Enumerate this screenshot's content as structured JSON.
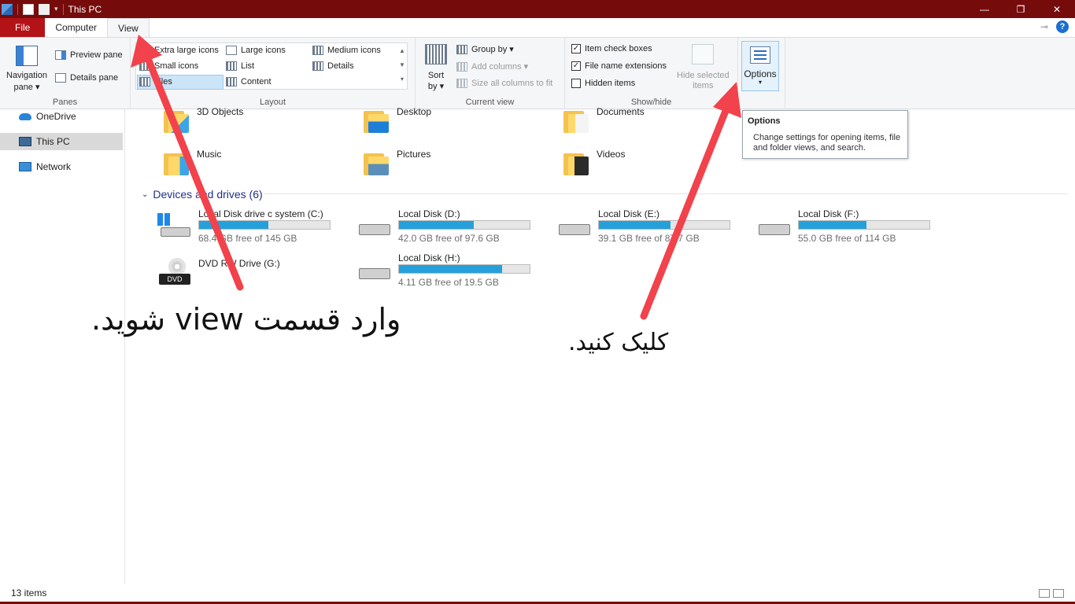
{
  "window": {
    "title": "This PC",
    "minimize": "—",
    "maximize": "❐",
    "close": "✕"
  },
  "tabs": {
    "file": "File",
    "computer": "Computer",
    "view": "View",
    "help": "?"
  },
  "ribbon": {
    "panes": {
      "label": "Panes",
      "navigation_pane": "Navigation",
      "navigation_pane_line2": "pane ▾",
      "preview_pane": "Preview pane",
      "details_pane": "Details pane"
    },
    "layout": {
      "label": "Layout",
      "extra_large_icons": "Extra large icons",
      "large_icons": "Large icons",
      "medium_icons": "Medium icons",
      "small_icons": "Small icons",
      "list": "List",
      "details": "Details",
      "tiles": "Tiles",
      "content": "Content"
    },
    "current_view": {
      "label": "Current view",
      "sort_by": "Sort",
      "sort_by_line2": "by ▾",
      "group_by": "Group by ▾",
      "add_columns": "Add columns ▾",
      "size_all_columns": "Size all columns to fit"
    },
    "show_hide": {
      "label": "Show/hide",
      "item_check_boxes": "Item check boxes",
      "file_name_extensions": "File name extensions",
      "hidden_items": "Hidden items",
      "hide_selected_items": "Hide selected",
      "hide_selected_items_line2": "items",
      "item_check_boxes_checked": true,
      "file_name_extensions_checked": true,
      "hidden_items_checked": false
    },
    "options": {
      "label": "Options",
      "arrow": "▾"
    }
  },
  "tooltip": {
    "title": "Options",
    "body": "Change settings for opening items, file and folder views, and search."
  },
  "nav": {
    "items": [
      {
        "label": "OneDrive",
        "icon": "cloud-icon"
      },
      {
        "label": "This PC",
        "icon": "computer-icon"
      },
      {
        "label": "Network",
        "icon": "network-icon"
      }
    ]
  },
  "folders": [
    {
      "label": "3D Objects"
    },
    {
      "label": "Desktop"
    },
    {
      "label": "Documents"
    },
    {
      "label": "Music"
    },
    {
      "label": "Pictures"
    },
    {
      "label": "Videos"
    }
  ],
  "devices": {
    "header": "Devices and drives (6)",
    "drives": [
      {
        "name": "Local Disk drive c system (C:)",
        "free": "68.4 GB free of 145 GB",
        "used_fraction": 0.53
      },
      {
        "name": "Local Disk (D:)",
        "free": "42.0 GB free of 97.6 GB",
        "used_fraction": 0.57
      },
      {
        "name": "Local Disk (E:)",
        "free": "39.1 GB free of 87.7 GB",
        "used_fraction": 0.55
      },
      {
        "name": "Local Disk (F:)",
        "free": "55.0 GB free of 114 GB",
        "used_fraction": 0.52
      },
      {
        "name": "DVD RW Drive (G:)",
        "free": "",
        "used_fraction": null
      },
      {
        "name": "Local Disk (H:)",
        "free": "4.11 GB free of 19.5 GB",
        "used_fraction": 0.79
      }
    ]
  },
  "status": {
    "items_count": "13 items"
  },
  "annotations": {
    "enter_view_text": "وارد قسمت view شوید.",
    "click_text": "کلیک کنید.",
    "arrow_color": "#f2424b"
  },
  "colors": {
    "titlebar": "#760b0c",
    "file_tab": "#b31217",
    "drive_fill": "#26a0da"
  }
}
